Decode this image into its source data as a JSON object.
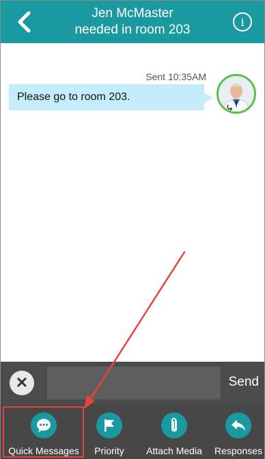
{
  "header": {
    "title_line1": "Jen McMaster",
    "title_line2": "needed in room 203",
    "back_icon": "chevron-left-icon",
    "info_icon": "info-icon",
    "info_glyph": "i",
    "color": "#1a9aa0"
  },
  "conversation": {
    "messages": [
      {
        "status": "Sent 10:35AM",
        "text": "Please go to room 203.",
        "bubble_color": "#c4ecfb",
        "avatar_border_color": "#55c148"
      }
    ]
  },
  "compose": {
    "clear_icon": "close-icon",
    "clear_glyph": "✕",
    "input_value": "",
    "send_label": "Send"
  },
  "toolbar": {
    "items": [
      {
        "label": "Quick Messages",
        "icon": "chat-bubble-icon"
      },
      {
        "label": "Priority",
        "icon": "flag-icon"
      },
      {
        "label": "Attach Media",
        "icon": "paperclip-icon"
      },
      {
        "label": "Responses",
        "icon": "reply-arrow-icon"
      }
    ]
  },
  "annotation": {
    "highlight_color": "#e8433f"
  }
}
